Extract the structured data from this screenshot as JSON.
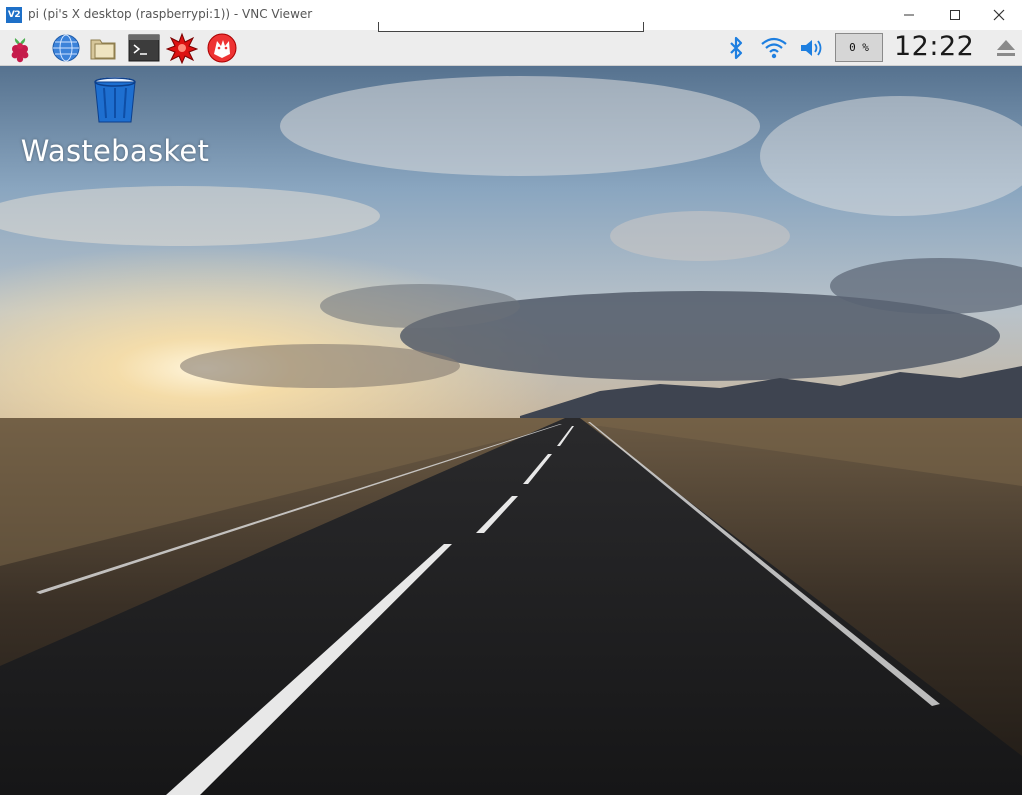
{
  "window": {
    "logo_text": "V2",
    "title": "pi (pi's X desktop (raspberrypi:1)) - VNC Viewer",
    "controls": [
      "minimize-icon",
      "maximize-icon",
      "close-icon"
    ]
  },
  "panel": {
    "launchers": [
      "raspberry-menu-icon",
      "web-browser-icon",
      "file-manager-icon",
      "terminal-icon",
      "math-kernel-icon",
      "wolfram-icon"
    ],
    "tray": [
      "bluetooth-icon",
      "wifi-icon",
      "volume-icon"
    ],
    "cpu_usage": "0 %",
    "clock": "12:22",
    "eject_icon": "eject-icon"
  },
  "desktop": {
    "icons": [
      {
        "label": "Wastebasket",
        "icon": "trash-icon"
      }
    ]
  },
  "colors": {
    "accent": "#1e70c8",
    "panel_bg": "#ededed",
    "bluetooth": "#1e7fe0"
  }
}
